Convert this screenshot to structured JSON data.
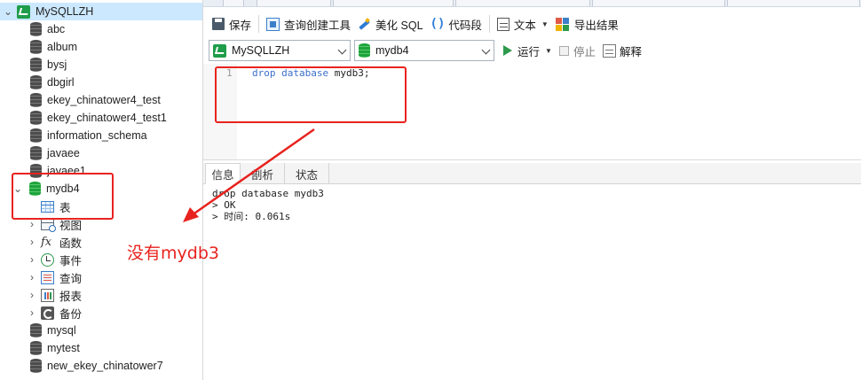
{
  "tree": {
    "connection": "MySQLLZH",
    "databases_above": [
      "abc",
      "album",
      "bysj",
      "dbgirl",
      "ekey_chinatower4_test",
      "ekey_chinatower4_test1",
      "information_schema",
      "javaee",
      "javaee1"
    ],
    "expanded_db": "mydb4",
    "children": [
      {
        "label": "表",
        "icon": "table-icon"
      },
      {
        "label": "视图",
        "icon": "view-icon"
      },
      {
        "label": "函数",
        "icon": "function-icon"
      },
      {
        "label": "事件",
        "icon": "event-icon"
      },
      {
        "label": "查询",
        "icon": "query-icon"
      },
      {
        "label": "报表",
        "icon": "report-icon"
      },
      {
        "label": "备份",
        "icon": "backup-icon"
      }
    ],
    "databases_below": [
      "mysql",
      "mytest",
      "new_ekey_chinatower7"
    ]
  },
  "toolbar": {
    "save": "保存",
    "query_builder": "查询创建工具",
    "beautify": "美化 SQL",
    "code_snippet": "代码段",
    "text": "文本",
    "export": "导出结果"
  },
  "selectors": {
    "connection": "MySQLLZH",
    "database": "mydb4",
    "run": "运行",
    "stop": "停止",
    "explain": "解释"
  },
  "editor": {
    "line_number": "1",
    "code": [
      "drop",
      "database",
      "mydb3;"
    ]
  },
  "results": {
    "tabs": [
      "信息",
      "剖析",
      "状态"
    ],
    "lines": [
      "drop database mydb3",
      "> OK",
      "> 时间: 0.061s"
    ]
  },
  "annotation": {
    "text": "没有mydb3",
    "color": "#e8231f"
  },
  "colors": {
    "selection": "#cce8ff",
    "db_active": "#1ea33b",
    "keyword": "#3d6fc9"
  }
}
